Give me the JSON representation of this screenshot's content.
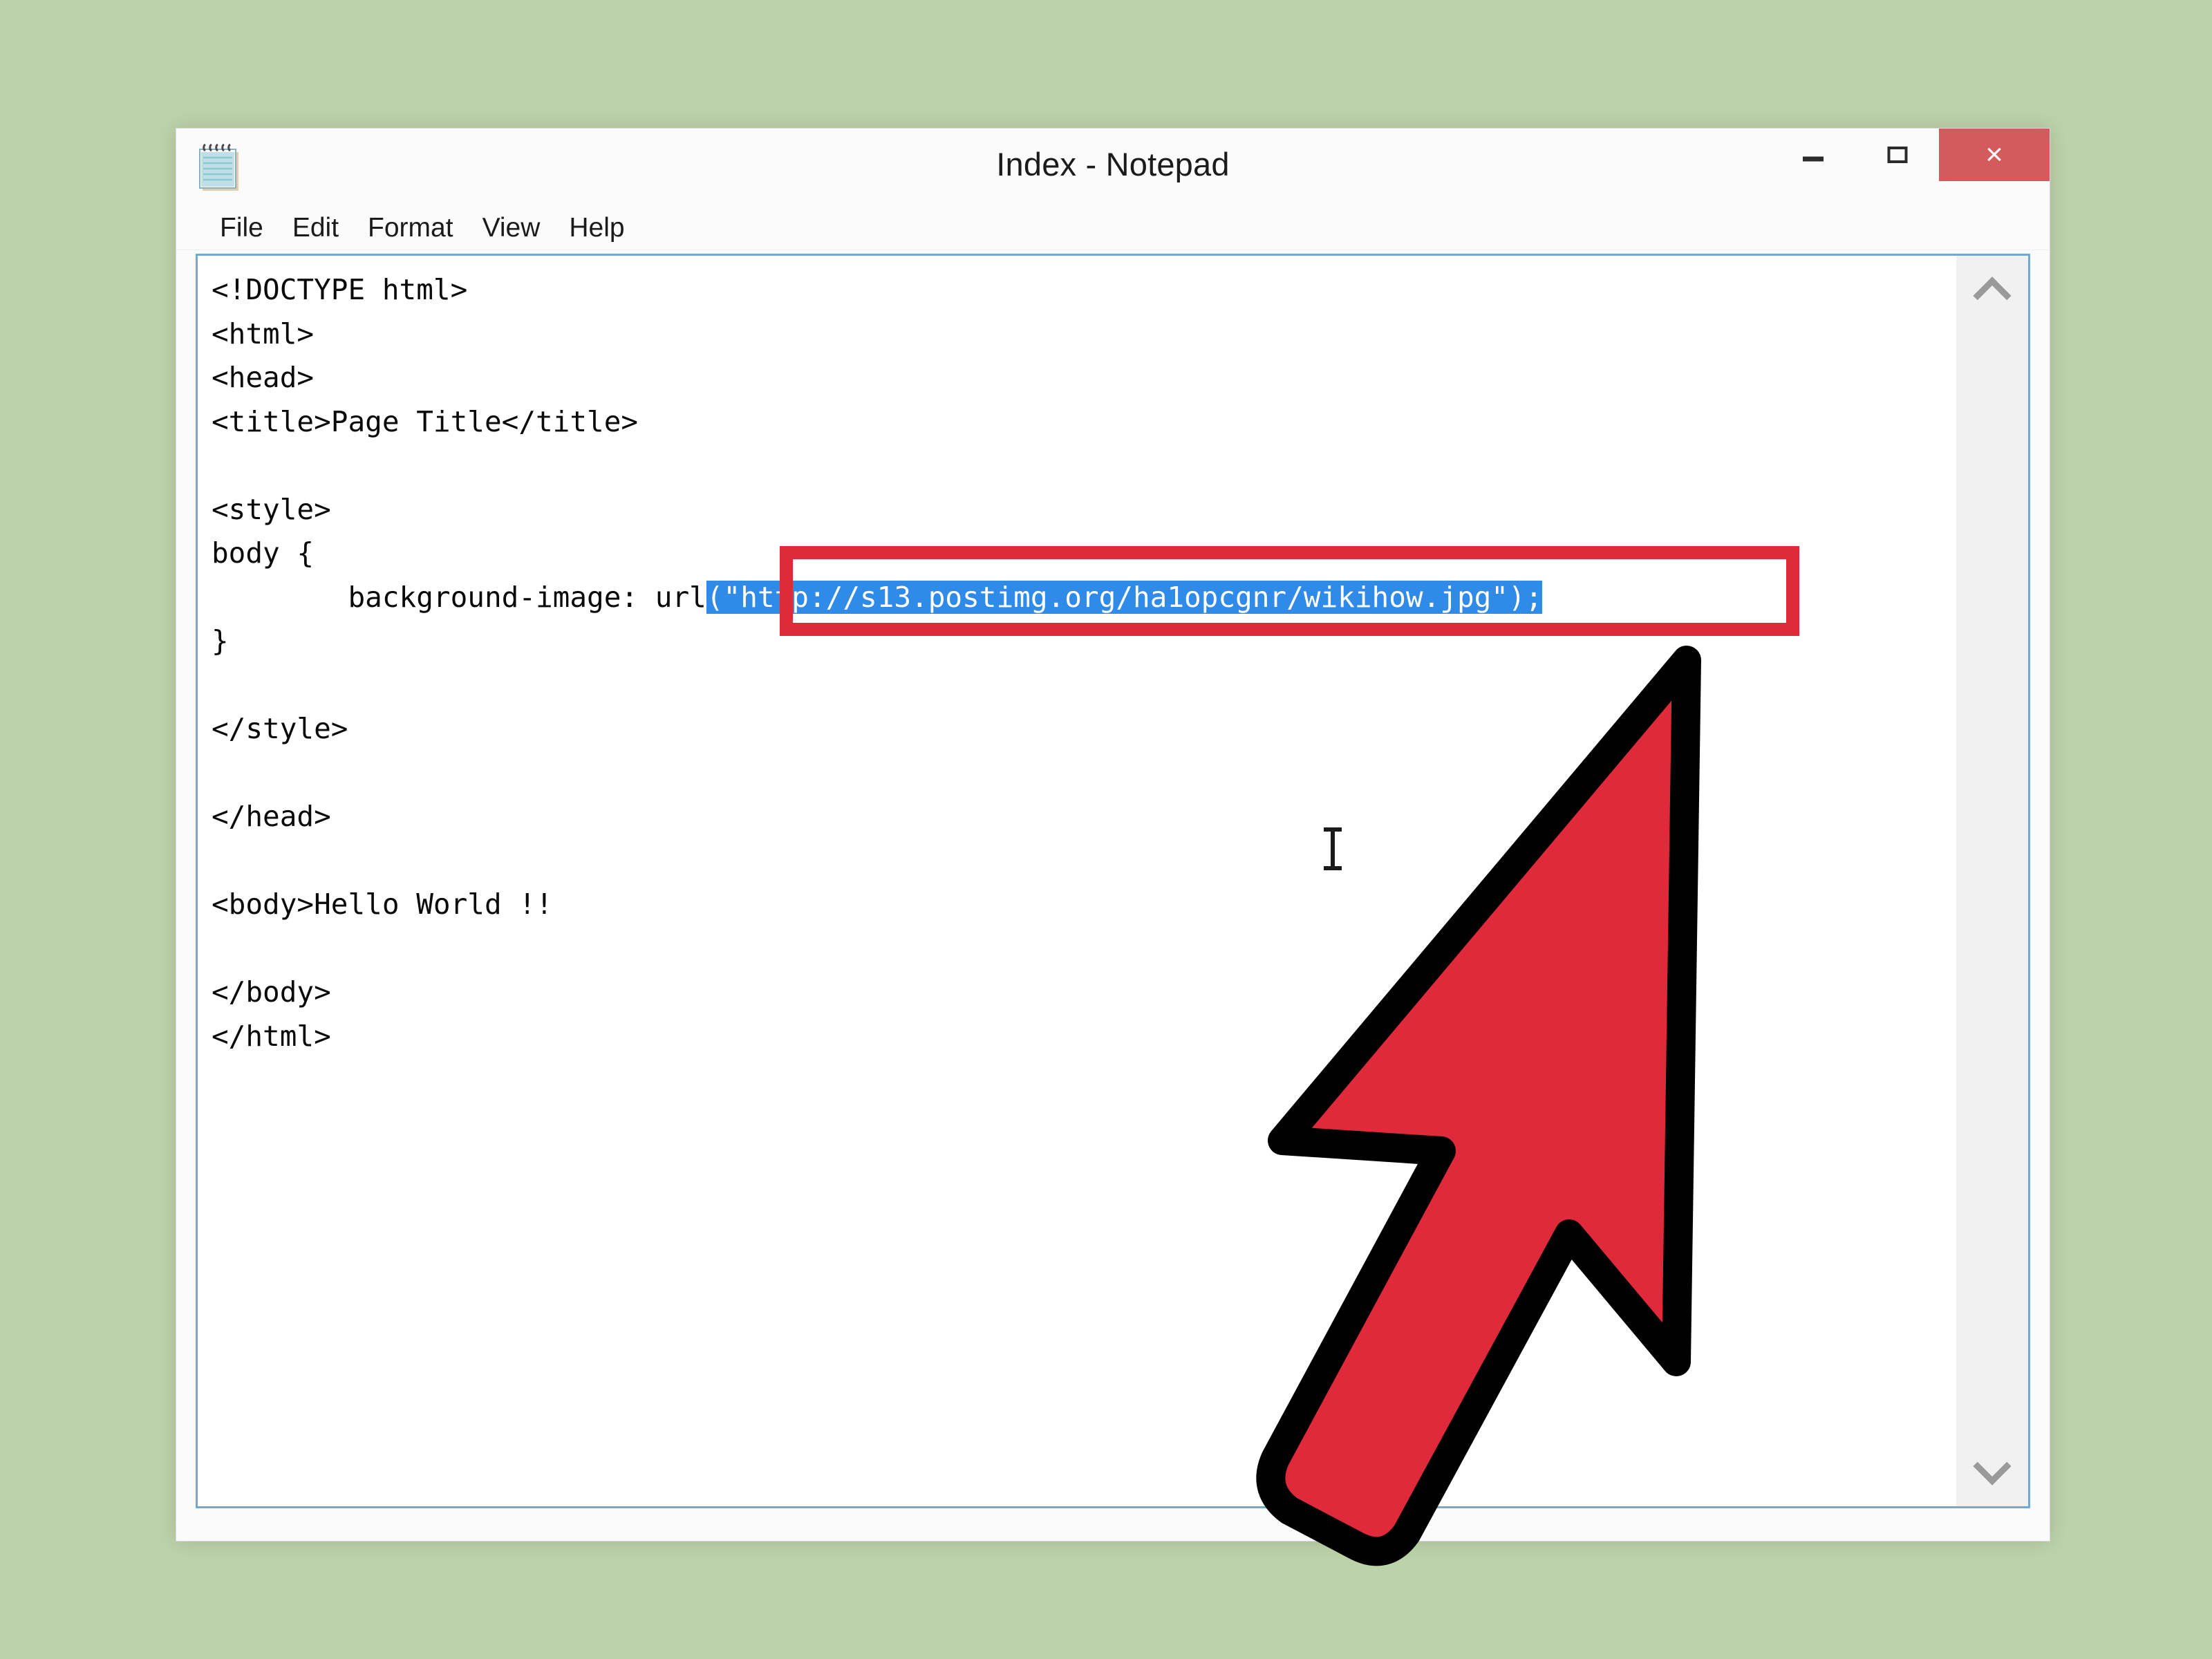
{
  "background": {
    "color": "#bcd2a8"
  },
  "window": {
    "title": "Index - Notepad",
    "icon": "notepad-icon",
    "controls": {
      "minimize_label": "–",
      "maximize_label": "☐",
      "close_label": "×",
      "close_color": "#d35b5b"
    }
  },
  "menu": {
    "items": [
      {
        "label": "File"
      },
      {
        "label": "Edit"
      },
      {
        "label": "Format"
      },
      {
        "label": "View"
      },
      {
        "label": "Help"
      }
    ]
  },
  "editor": {
    "border_color": "#6fa8dc",
    "selection_color": "#2f8ae8",
    "lines_before": "<!DOCTYPE html>\n<html>\n<head>\n<title>Page Title</title>\n\n<style>\nbody {\n        background-image: url",
    "selected_text": "(\"http://s13.postimg.org/ha1opcgnr/wikihow.jpg\");",
    "lines_after": "\n}\n\n</style>\n\n</head>\n\n<body>Hello World !!\n\n</body>\n</html>",
    "url_value": "http://s13.postimg.org/ha1opcgnr/wikihow.jpg"
  },
  "scrollbar": {
    "up_arrow": "chevron-up-icon",
    "down_arrow": "chevron-down-icon"
  },
  "annotations": {
    "highlight_box_color": "#dd2b39",
    "arrow_fill": "#e02a3c",
    "arrow_stroke": "#000000",
    "cursor": "i-beam-cursor"
  }
}
